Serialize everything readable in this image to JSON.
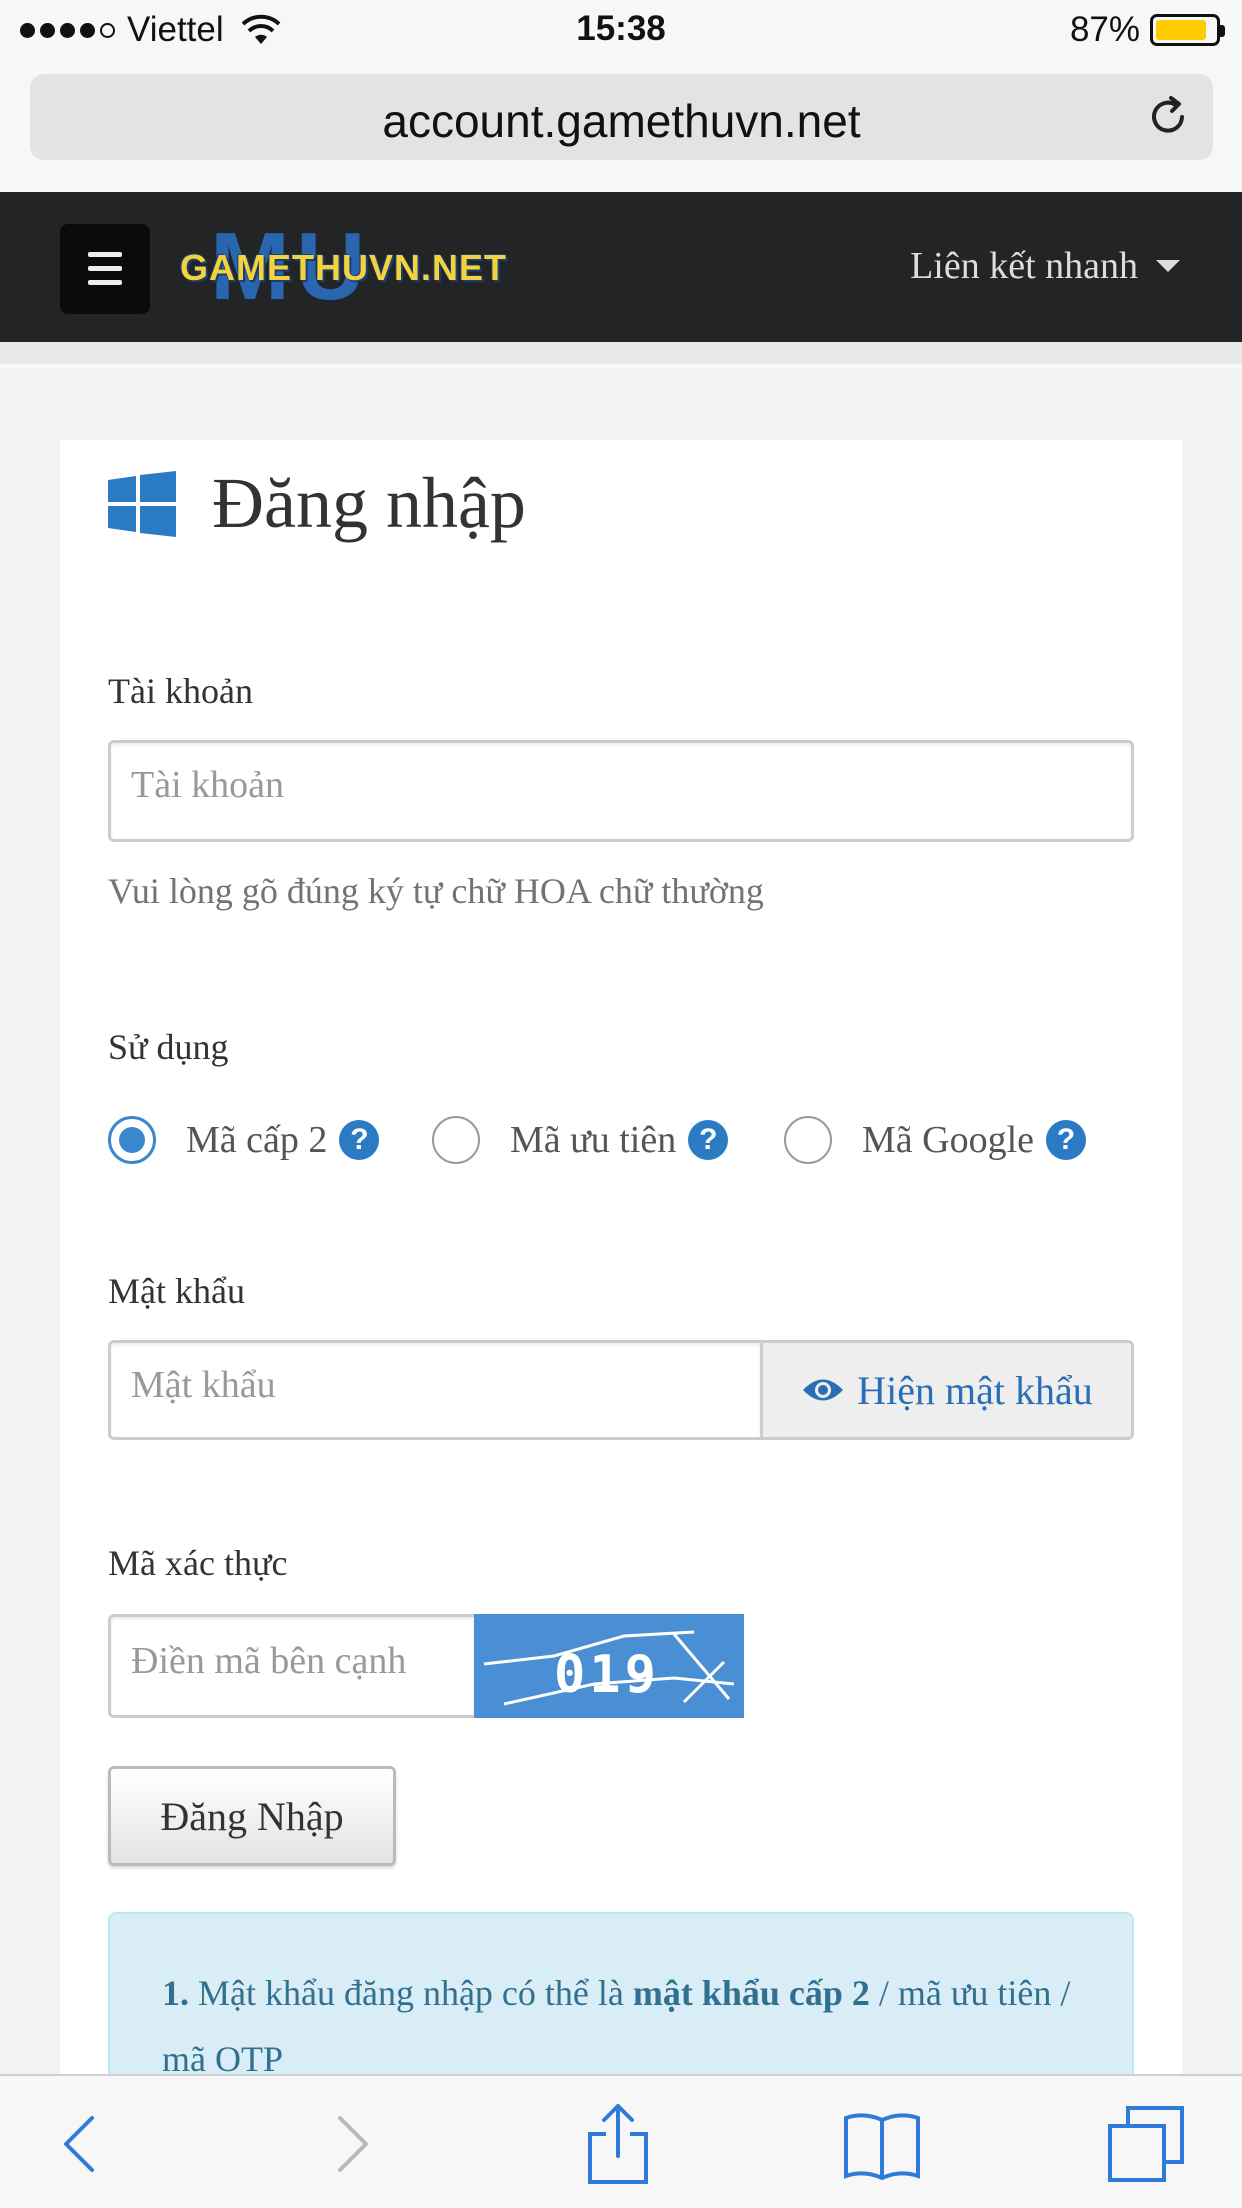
{
  "status_bar": {
    "carrier": "Viettel",
    "time": "15:38",
    "battery_percent": "87%",
    "battery_level": 0.87,
    "signal_bars_filled": 4,
    "signal_bars_total": 5
  },
  "browser": {
    "url": "account.gamethuvn.net",
    "reload_icon": "reload-icon",
    "toolbar_icons": [
      "back-icon",
      "forward-icon",
      "share-icon",
      "bookmarks-icon",
      "tabs-icon"
    ]
  },
  "navbar": {
    "menu_icon": "hamburger-icon",
    "logo_text": "GAMETHUVN.NET",
    "logo_bg_text": "MU",
    "quick_links_label": "Liên kết nhanh"
  },
  "login": {
    "title": "Đăng nhập",
    "title_icon": "windows-icon",
    "account_label": "Tài khoản",
    "account_placeholder": "Tài khoản",
    "account_help": "Vui lòng gõ đúng ký tự chữ HOA chữ thường",
    "use_label": "Sử dụng",
    "options": [
      {
        "label": "Mã cấp 2",
        "checked": true
      },
      {
        "label": "Mã ưu tiên",
        "checked": false
      },
      {
        "label": "Mã Google",
        "checked": false
      }
    ],
    "password_label": "Mật khẩu",
    "password_placeholder": "Mật khẩu",
    "show_password_label": "Hiện mật khẩu",
    "captcha_label": "Mã xác thực",
    "captcha_placeholder": "Điền mã bên cạnh",
    "captcha_text": "019",
    "submit_label": "Đăng Nhập"
  },
  "info": {
    "num": "1.",
    "text_a": " Mật khẩu đăng nhập có thể là ",
    "text_bold": "mật khẩu cấp 2",
    "text_b": " / mã ưu tiên / mã OTP"
  },
  "colors": {
    "navbar_bg": "#222426",
    "accent": "#3a87cf",
    "info_bg": "#d9edf7",
    "info_text": "#31708f",
    "battery": "#ffcc00"
  }
}
